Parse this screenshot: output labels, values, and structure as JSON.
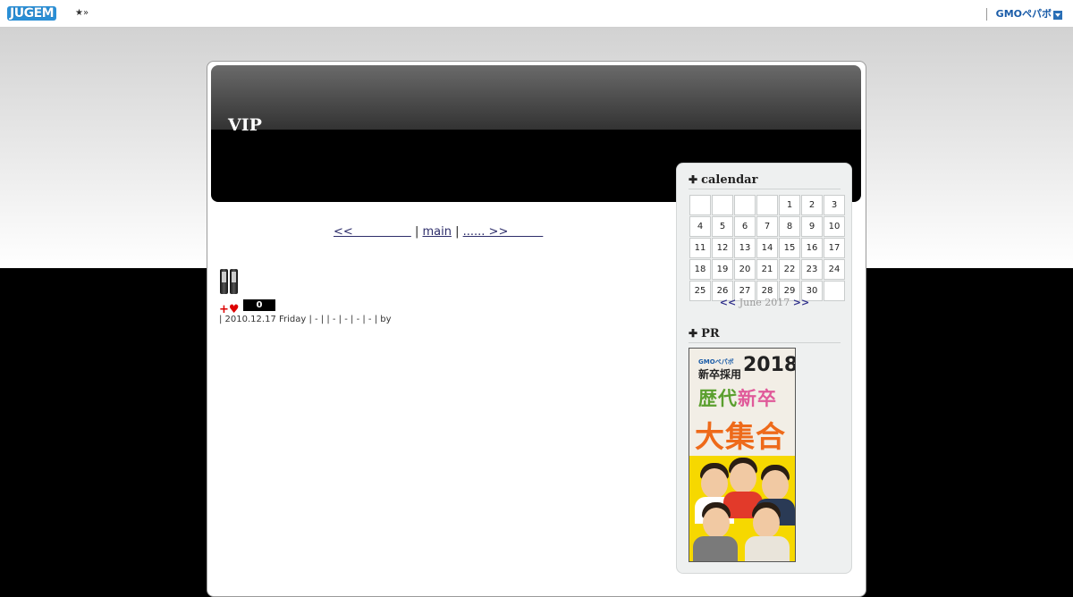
{
  "topbar": {
    "logo": "JUGEM",
    "logo_mark": "★»",
    "partner": "GMOペパボ"
  },
  "blog": {
    "title": "VIP"
  },
  "nav": {
    "prev": "<<　　　　　",
    "sep1": "|",
    "main": "main",
    "sep2": "|",
    "next": "...... >>　　　"
  },
  "entry": {
    "count": "0",
    "meta": "| 2010.12.17 Friday | - | | - | - | - | - | by"
  },
  "sidebar": {
    "calendar_title": "calendar",
    "calendar_rows": [
      [
        "",
        "",
        "",
        "",
        "1",
        "2",
        "3"
      ],
      [
        "4",
        "5",
        "6",
        "7",
        "8",
        "9",
        "10"
      ],
      [
        "11",
        "12",
        "13",
        "14",
        "15",
        "16",
        "17"
      ],
      [
        "18",
        "19",
        "20",
        "21",
        "22",
        "23",
        "24"
      ],
      [
        "25",
        "26",
        "27",
        "28",
        "29",
        "30",
        ""
      ]
    ],
    "cal_prev": "<<",
    "cal_month": "June 2017",
    "cal_next": ">>",
    "pr_title": "PR",
    "pr_banner": {
      "brand": "GMOペパボ",
      "line1": "新卒採用",
      "year": "2018",
      "line2a": "歴代",
      "line2b": "新卒",
      "line3": "大集合"
    }
  },
  "colors": {
    "accent_link": "#2d2d6a",
    "heart": "#dd0000"
  }
}
